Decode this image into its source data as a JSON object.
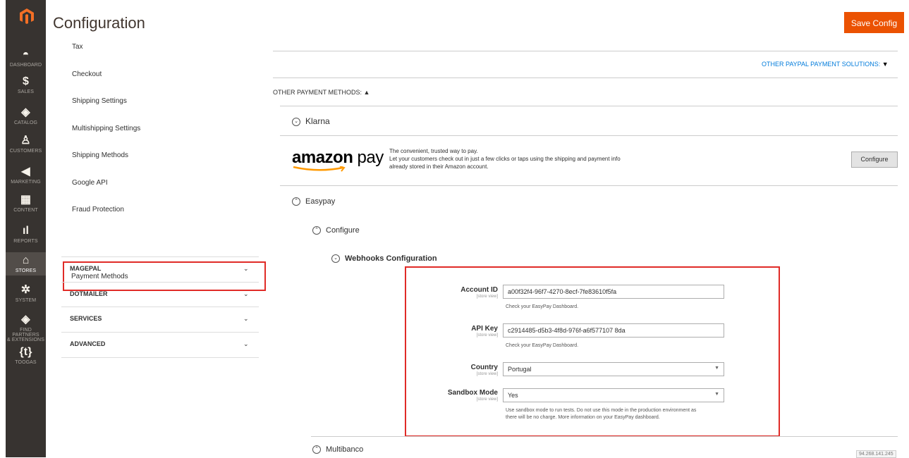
{
  "header": {
    "title": "Configuration",
    "save_label": "Save Config"
  },
  "nav": [
    {
      "label": "DASHBOARD",
      "icon": "dashboard-icon",
      "glyph": "◓"
    },
    {
      "label": "SALES",
      "icon": "dollar-icon",
      "glyph": "$"
    },
    {
      "label": "CATALOG",
      "icon": "cube-icon",
      "glyph": "◈"
    },
    {
      "label": "CUSTOMERS",
      "icon": "person-icon",
      "glyph": "♙"
    },
    {
      "label": "MARKETING",
      "icon": "megaphone-icon",
      "glyph": "◀"
    },
    {
      "label": "CONTENT",
      "icon": "layout-icon",
      "glyph": "▦"
    },
    {
      "label": "REPORTS",
      "icon": "bar-chart-icon",
      "glyph": "ıl"
    },
    {
      "label": "STORES",
      "icon": "store-icon",
      "glyph": "⌂"
    },
    {
      "label": "SYSTEM",
      "icon": "gear-icon",
      "glyph": "✲"
    },
    {
      "label": "FIND PARTNERS",
      "label2": "& EXTENSIONS",
      "icon": "extensions-icon",
      "glyph": "◈"
    },
    {
      "label": "TOOGAS",
      "icon": "toogas-icon",
      "glyph": "{t}"
    }
  ],
  "sidebar": {
    "items": [
      "Tax",
      "Checkout",
      "Shipping Settings",
      "Multishipping Settings",
      "Shipping Methods",
      "Google API",
      "Fraud Protection"
    ],
    "active": "Payment Methods",
    "sections": [
      "MAGEPAL",
      "DOTMAILER",
      "SERVICES",
      "ADVANCED"
    ]
  },
  "main": {
    "other_paypal": "OTHER PAYPAL PAYMENT SOLUTIONS:",
    "other_methods": "OTHER PAYMENT METHODS:",
    "klarna": "Klarna",
    "amazon": {
      "logo_amazon": "amazon",
      "logo_pay": "pay",
      "line1": "The convenient, trusted way to pay.",
      "line2": "Let your customers check out in just a few clicks or taps using the shipping and payment info",
      "line3": "already stored in their Amazon account.",
      "configure": "Configure"
    },
    "easypay": "Easypay",
    "configure_group": "Configure",
    "webhooks": "Webhooks Configuration",
    "fields": {
      "account_id": {
        "label": "Account ID",
        "scope": "[store view]",
        "value": "a00f32f4-96f7-4270-8ecf-7fe83610f5fa",
        "note": "Check your EasyPay Dashboard."
      },
      "api_key": {
        "label": "API Key",
        "scope": "[store view]",
        "value": "c2914485-d5b3-4f8d-976f-a6f577107 8da",
        "note": "Check your EasyPay Dashboard."
      },
      "country": {
        "label": "Country",
        "scope": "[store view]",
        "value": "Portugal"
      },
      "sandbox": {
        "label": "Sandbox Mode",
        "scope": "[store view]",
        "value": "Yes",
        "note1": "Use sandbox mode to run tests. Do not use this mode in the production environment as",
        "note2": "there will be no charge. More information on your EasyPay dashboard."
      }
    },
    "multibanco": "Multibanco",
    "corner": "94.268.141.245"
  }
}
